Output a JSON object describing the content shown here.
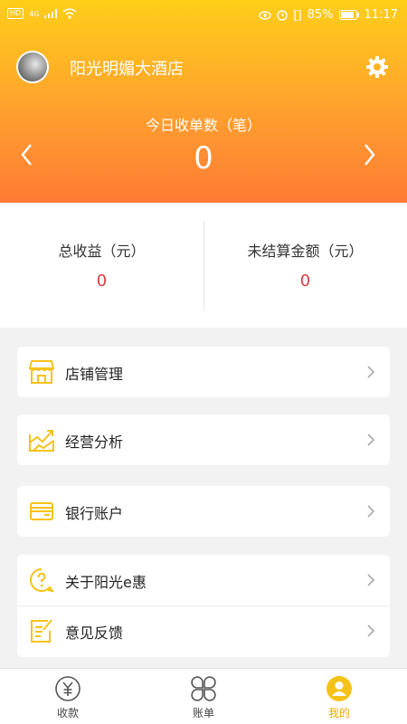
{
  "status_bar": {
    "left_chip": "HD",
    "network": "4G",
    "battery": "85%",
    "time": "11:17"
  },
  "header": {
    "store_name": "阳光明媚大酒店",
    "today_orders_label": "今日收单数（笔）",
    "today_orders_value": "0"
  },
  "stats": {
    "total_income_label": "总收益（元）",
    "total_income_value": "0",
    "unsettled_label": "未结算金额（元）",
    "unsettled_value": "0"
  },
  "menu": {
    "store_management": "店铺管理",
    "business_analysis": "经营分析",
    "bank_account": "银行账户",
    "about": "关于阳光e惠",
    "feedback": "意见反馈"
  },
  "tabs": {
    "collect": "收款",
    "bill": "账单",
    "mine": "我的"
  },
  "colors": {
    "header_top": "#ffce1a",
    "header_bottom": "#ff7a35",
    "icon_yellow": "#f5c21a",
    "value_red": "#d94040",
    "active_tab": "#f0a800"
  }
}
